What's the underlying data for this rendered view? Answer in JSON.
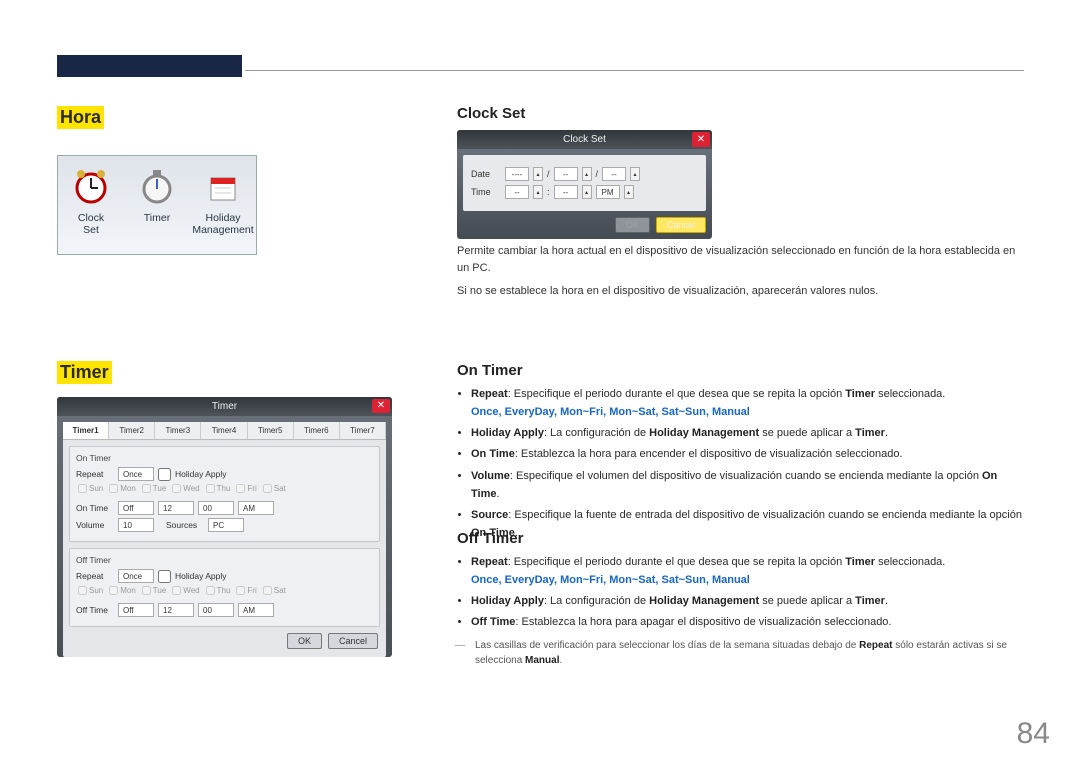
{
  "page_number": "84",
  "sections": {
    "hora": {
      "title": "Hora"
    },
    "timer_hl": {
      "title": "Timer"
    }
  },
  "iconstrip": {
    "clock_set": "Clock\nSet",
    "timer": "Timer",
    "holiday": "Holiday\nManagement"
  },
  "clockset": {
    "heading": "Clock Set",
    "dlg_title": "Clock Set",
    "close": "✕",
    "date_label": "Date",
    "time_label": "Time",
    "dash": "----",
    "dd": "--",
    "sl": "/",
    "col": ":",
    "pm": "PM",
    "ok": "OK",
    "cancel": "Cancel",
    "p1": "Permite cambiar la hora actual en el dispositivo de visualización seleccionado en función de la hora establecida en un PC.",
    "p2": "Si no se establece la hora en el dispositivo de visualización, aparecerán valores nulos."
  },
  "timer_dlg": {
    "title": "Timer",
    "close": "✕",
    "tabs": [
      "Timer1",
      "Timer2",
      "Timer3",
      "Timer4",
      "Timer5",
      "Timer6",
      "Timer7"
    ],
    "on_grp": "On Timer",
    "off_grp": "Off Timer",
    "repeat": "Repeat",
    "once": "Once",
    "holiday_apply": "Holiday Apply",
    "on_time": "On Time",
    "off_time": "Off Time",
    "off": "Off",
    "volume": "Volume",
    "sources": "Sources",
    "pc": "PC",
    "h": "12",
    "m": "00",
    "ampm": "AM",
    "vval": "10",
    "days": [
      "Sun",
      "Mon",
      "Tue",
      "Wed",
      "Thu",
      "Fri",
      "Sat"
    ],
    "ok": "OK",
    "cancel": "Cancel"
  },
  "on_timer": {
    "heading": "On Timer",
    "repeat_lead": "Repeat",
    "repeat_txt": ": Especifique el periodo durante el que desea que se repita la opción ",
    "timer_word": "Timer",
    "selected": " seleccionada.",
    "options": "Once, EveryDay, Mon~Fri, Mon~Sat, Sat~Sun, Manual",
    "holiday_apply": "Holiday Apply",
    "holiday_txt1": ": La configuración de ",
    "holiday_mgmt": "Holiday Management",
    "holiday_txt2": " se puede aplicar a ",
    "holiday_period": ".",
    "on_time": "On Time",
    "on_time_txt": ": Establezca la hora para encender el dispositivo de visualización seleccionado.",
    "volume": "Volume",
    "volume_txt": ": Especifique el volumen del dispositivo de visualización cuando se encienda mediante la opción ",
    "on_time_ref": "On Time",
    "volume_period": ".",
    "source": "Source",
    "source_txt": ": Especifique la fuente de entrada del dispositivo de visualización cuando se encienda mediante la opción ",
    "on_time_ref2": "On Time",
    "source_period": "."
  },
  "off_timer": {
    "heading": "Off Timer",
    "repeat_lead": "Repeat",
    "repeat_txt": ": Especifique el periodo durante el que desea que se repita la opción ",
    "timer_word": "Timer",
    "selected": " seleccionada.",
    "options": "Once, EveryDay, Mon~Fri, Mon~Sat, Sat~Sun, Manual",
    "holiday_apply": "Holiday Apply",
    "holiday_txt1": ": La configuración de ",
    "holiday_mgmt": "Holiday Management",
    "holiday_txt2": " se puede aplicar a ",
    "holiday_period": ".",
    "off_time": "Off Time",
    "off_time_txt": ": Establezca la hora para apagar el dispositivo de visualización seleccionado.",
    "footnote1": "Las casillas de verificación para seleccionar los días de la semana situadas debajo de ",
    "footnote_repeat": "Repeat",
    "footnote2": " sólo estarán activas si se selecciona ",
    "footnote_manual": "Manual",
    "footnote_period": "."
  }
}
